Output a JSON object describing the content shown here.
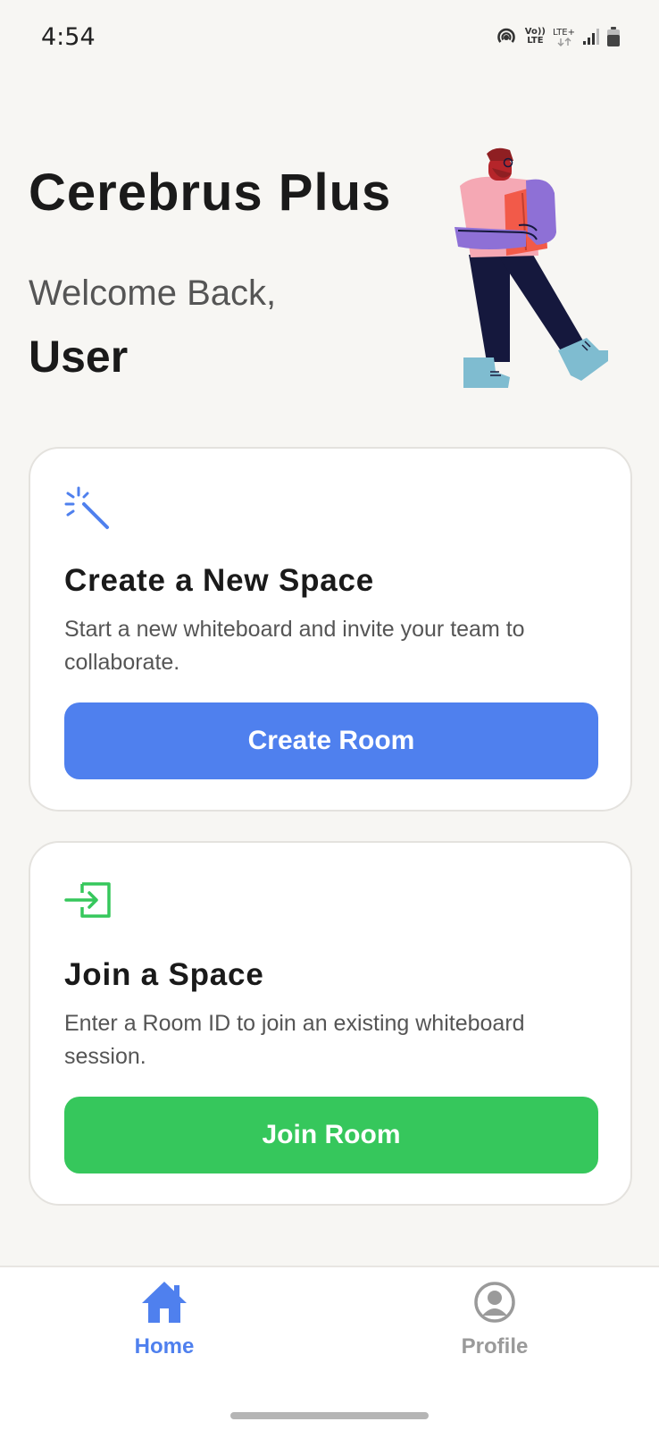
{
  "status_bar": {
    "time": "4:54",
    "network_top": "Vo))",
    "network_bottom": "LTE",
    "lte_label": "LTE+",
    "icons": [
      "hotspot-icon",
      "volte-icon",
      "lte-plus-icon",
      "signal-icon",
      "battery-icon"
    ]
  },
  "header": {
    "app_title": "Cerebrus Plus",
    "welcome_text": "Welcome Back,",
    "user_name": "User"
  },
  "cards": {
    "create": {
      "icon": "magic-wand-icon",
      "title": "Create a New Space",
      "description": "Start a new whiteboard and invite your team to collaborate.",
      "button_label": "Create Room",
      "button_color": "#4f80ee"
    },
    "join": {
      "icon": "enter-icon",
      "title": "Join a Space",
      "description": "Enter a Room ID to join an existing whiteboard session.",
      "button_label": "Join Room",
      "button_color": "#36c75c"
    }
  },
  "bottom_nav": {
    "items": [
      {
        "label": "Home",
        "icon": "home-icon",
        "active": true
      },
      {
        "label": "Profile",
        "icon": "profile-icon",
        "active": false
      }
    ],
    "active_color": "#4f80ee",
    "inactive_color": "#9a9a9a"
  }
}
